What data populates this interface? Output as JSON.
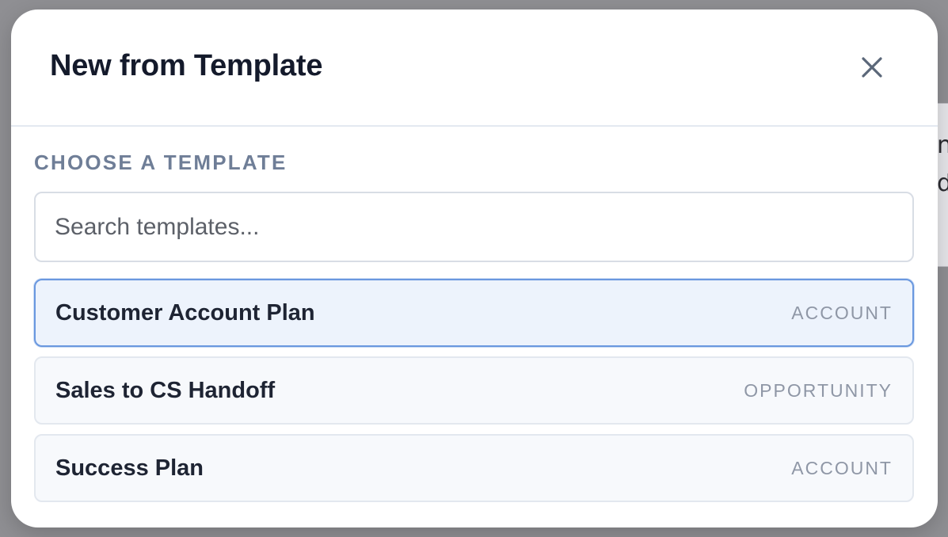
{
  "modal": {
    "title": "New from Template",
    "close_icon": "close-icon"
  },
  "section": {
    "label": "CHOOSE A TEMPLATE"
  },
  "search": {
    "placeholder": "Search templates...",
    "value": ""
  },
  "templates": [
    {
      "name": "Customer Account Plan",
      "type": "ACCOUNT",
      "selected": true
    },
    {
      "name": "Sales to CS Handoff",
      "type": "OPPORTUNITY",
      "selected": false
    },
    {
      "name": "Success Plan",
      "type": "ACCOUNT",
      "selected": false
    }
  ],
  "colors": {
    "selected_border": "#6a98df",
    "selected_background": "#edf3fc",
    "title_text": "#141a2b",
    "label_text": "#6f7e97"
  }
}
